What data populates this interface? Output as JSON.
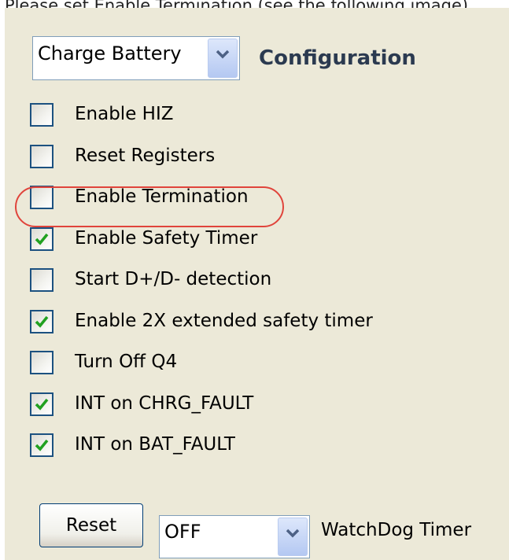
{
  "caption": "Please set Enable Termination (see the following image)",
  "mode_select": {
    "value": "Charge Battery",
    "arrow_icon": "chevron-down-icon"
  },
  "config_label": "Configuration",
  "options": [
    {
      "label": "Enable HIZ",
      "checked": false
    },
    {
      "label": "Reset Registers",
      "checked": false
    },
    {
      "label": "Enable Termination",
      "checked": false,
      "highlighted": true
    },
    {
      "label": "Enable Safety Timer",
      "checked": true
    },
    {
      "label": "Start D+/D- detection",
      "checked": false
    },
    {
      "label": "Enable 2X extended safety timer",
      "checked": true
    },
    {
      "label": "Turn Off Q4",
      "checked": false
    },
    {
      "label": "INT on CHRG_FAULT",
      "checked": true
    },
    {
      "label": "INT on BAT_FAULT",
      "checked": true
    }
  ],
  "reset_button": "Reset",
  "watchdog": {
    "value": "OFF",
    "label": "WatchDog Timer"
  },
  "colors": {
    "panel_bg": "#ECE9D8",
    "checkbox_border": "#1C5180",
    "checkmark": "#21A121",
    "highlight": "#E0443B",
    "combo_border": "#7F9DB9",
    "config_text": "#2B3A50"
  }
}
